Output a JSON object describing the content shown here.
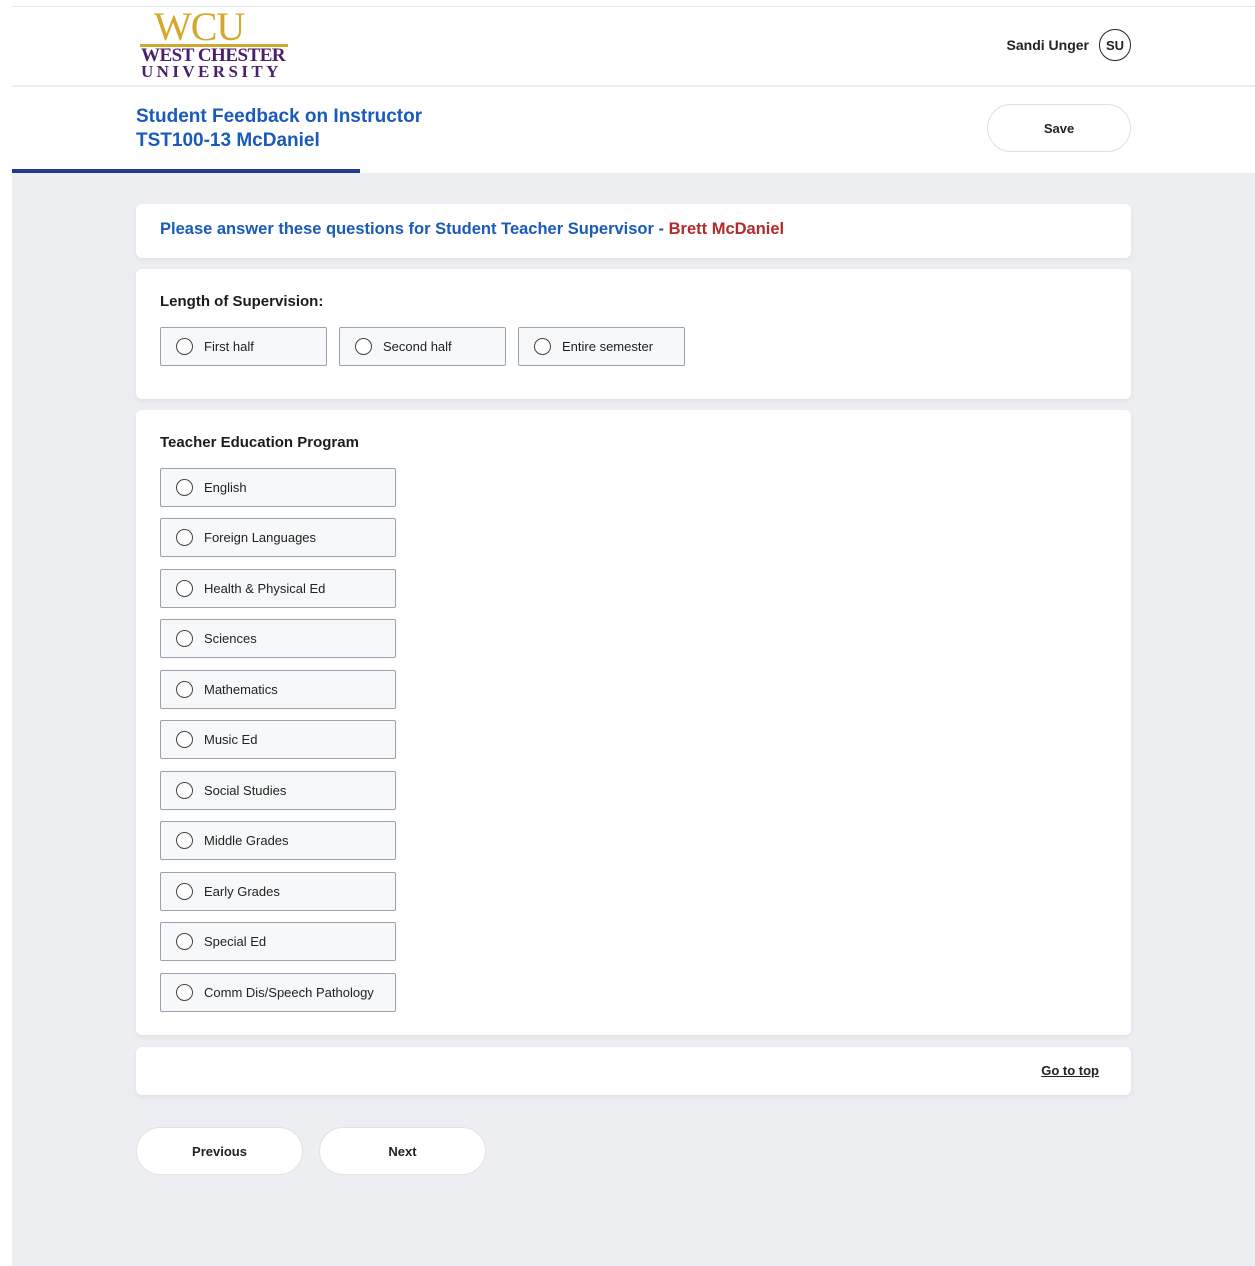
{
  "brand": {
    "logo_letters": "WCU",
    "logo_line1": "WEST CHESTER",
    "logo_line2": "UNIVERSITY",
    "colors": {
      "gold": "#d2a92c",
      "purple": "#4a1f6e"
    }
  },
  "user": {
    "name": "Sandi Unger",
    "initials": "SU"
  },
  "page": {
    "title_line1": "Student Feedback on Instructor",
    "title_line2": "TST100-13 McDaniel",
    "save_label": "Save"
  },
  "intro": {
    "question_prefix": "Please answer these questions for Student Teacher Supervisor - ",
    "supervisor_name": "Brett McDaniel"
  },
  "length_question": {
    "title": "Length of Supervision:",
    "options": [
      "First half",
      "Second half",
      "Entire semester"
    ]
  },
  "program_question": {
    "title": "Teacher Education Program",
    "options": [
      "English",
      "Foreign Languages",
      "Health & Physical Ed",
      "Sciences",
      "Mathematics",
      "Music Ed",
      "Social Studies",
      "Middle Grades",
      "Early Grades",
      "Special Ed",
      "Comm Dis/Speech Pathology"
    ]
  },
  "footer": {
    "go_to_top": "Go to top"
  },
  "nav": {
    "previous": "Previous",
    "next": "Next"
  },
  "theme": {
    "title_blue": "#1a5ab8",
    "accent_red": "#b22a2a",
    "tab_underline": "#213c8c"
  }
}
